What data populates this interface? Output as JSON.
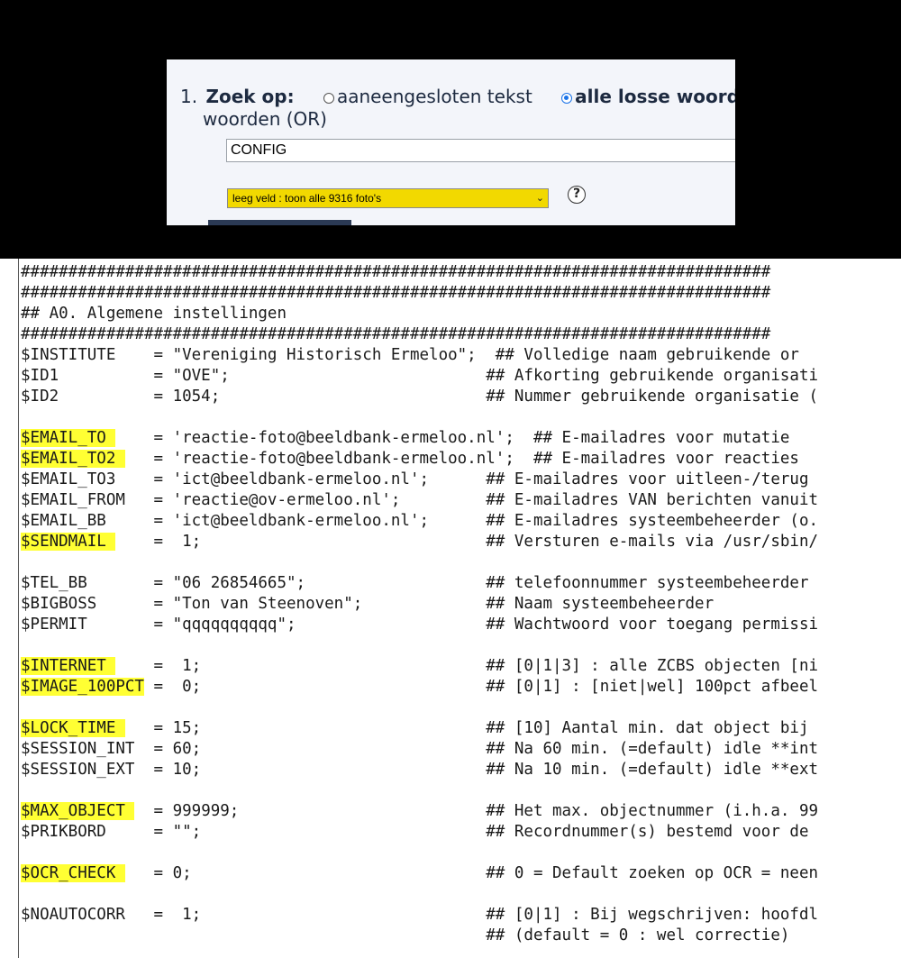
{
  "search": {
    "step_number": "1.",
    "label": "Zoek op:",
    "option_1_label": "aaneengesloten tekst",
    "option_2_label": "alle losse woorde",
    "option_2_continuation": "woorden (OR)",
    "input_value": "CONFIG",
    "select_value": "leeg veld : toon alle 9316 foto's",
    "help_icon": "question-circle-icon",
    "selected_option": 2
  },
  "colors": {
    "highlight": "#ffff33",
    "select_background": "#f2d900",
    "panel_background": "#f3f5fa"
  },
  "code_lines": [
    {
      "text": "###############################################################################",
      "hl": ""
    },
    {
      "text": "###############################################################################",
      "hl": ""
    },
    {
      "text": "## A0. Algemene instellingen",
      "hl": ""
    },
    {
      "text": "###############################################################################",
      "hl": ""
    },
    {
      "text": "$INSTITUTE    = \"Vereniging Historisch Ermeloo\";  ## Volledige naam gebruikende or",
      "hl": ""
    },
    {
      "text": "$ID1          = \"OVE\";                           ## Afkorting gebruikende organisati",
      "hl": ""
    },
    {
      "text": "$ID2          = 1054;                            ## Nummer gebruikende organisatie (",
      "hl": ""
    },
    {
      "text": "",
      "hl": ""
    },
    {
      "text": "$EMAIL_TO     = 'reactie-foto@beeldbank-ermeloo.nl';  ## E-mailadres voor mutatie",
      "hl": "$EMAIL_TO "
    },
    {
      "text": "$EMAIL_TO2    = 'reactie-foto@beeldbank-ermeloo.nl';  ## E-mailadres voor reacties",
      "hl": "$EMAIL_TO2 "
    },
    {
      "text": "$EMAIL_TO3    = 'ict@beeldbank-ermeloo.nl';      ## E-mailadres voor uitleen-/terug",
      "hl": ""
    },
    {
      "text": "$EMAIL_FROM   = 'reactie@ov-ermeloo.nl';         ## E-mailadres VAN berichten vanuit",
      "hl": ""
    },
    {
      "text": "$EMAIL_BB     = 'ict@beeldbank-ermeloo.nl';      ## E-mailadres systeembeheerder (o.",
      "hl": ""
    },
    {
      "text": "$SENDMAIL     =  1;                              ## Versturen e-mails via /usr/sbin/",
      "hl": "$SENDMAIL "
    },
    {
      "text": "",
      "hl": ""
    },
    {
      "text": "$TEL_BB       = \"06 26854665\";                   ## telefoonnummer systeembeheerder",
      "hl": ""
    },
    {
      "text": "$BIGBOSS      = \"Ton van Steenoven\";             ## Naam systeembeheerder",
      "hl": ""
    },
    {
      "text": "$PERMIT       = \"qqqqqqqqqq\";                    ## Wachtwoord voor toegang permissi",
      "hl": ""
    },
    {
      "text": "",
      "hl": ""
    },
    {
      "text": "$INTERNET     =  1;                              ## [0|1|3] : alle ZCBS objecten [ni",
      "hl": "$INTERNET "
    },
    {
      "text": "$IMAGE_100PCT =  0;                              ## [0|1] : [niet|wel] 100pct afbeel",
      "hl": "$IMAGE_100PCT"
    },
    {
      "text": "",
      "hl": ""
    },
    {
      "text": "$LOCK_TIME    = 15;                              ## [10] Aantal min. dat object bij",
      "hl": "$LOCK_TIME "
    },
    {
      "text": "$SESSION_INT  = 60;                              ## Na 60 min. (=default) idle **int",
      "hl": ""
    },
    {
      "text": "$SESSION_EXT  = 10;                              ## Na 10 min. (=default) idle **ext",
      "hl": ""
    },
    {
      "text": "",
      "hl": ""
    },
    {
      "text": "$MAX_OBJECT   = 999999;                          ## Het max. objectnummer (i.h.a. 99",
      "hl": "$MAX_OBJECT "
    },
    {
      "text": "$PRIKBORD     = \"\";                              ## Recordnummer(s) bestemd voor de",
      "hl": ""
    },
    {
      "text": "",
      "hl": ""
    },
    {
      "text": "$OCR_CHECK    = 0;                               ## 0 = Default zoeken op OCR = neen",
      "hl": "$OCR_CHECK "
    },
    {
      "text": "",
      "hl": ""
    },
    {
      "text": "$NOAUTOCORR   =  1;                              ## [0|1] : Bij wegschrijven: hoofdl",
      "hl": ""
    },
    {
      "text": "                                                 ## (default = 0 : wel correctie)",
      "hl": ""
    }
  ]
}
